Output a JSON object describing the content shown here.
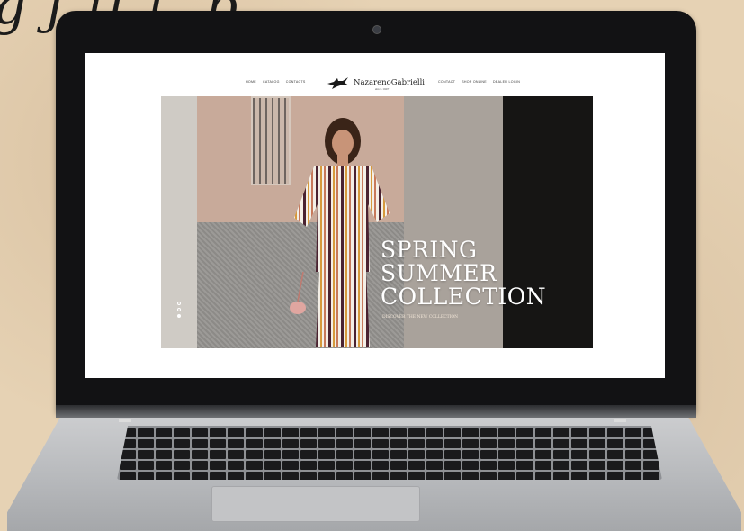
{
  "background_script_text": "g  ƒ   ff  ƒ, p",
  "website": {
    "nav_left": [
      "Home",
      "Catalog",
      "Contacts"
    ],
    "nav_right": [
      "Contact",
      "Shop Online",
      "Dealer Login"
    ],
    "brand": "NazarenoGabrielli",
    "brand_since": "since 1907",
    "hero": {
      "title_lines": [
        "SPRING",
        "SUMMER",
        "COLLECTION"
      ],
      "subtitle": "DISCOVER THE NEW COLLECTION",
      "slides": 3,
      "active_slide": 3
    }
  },
  "colors": {
    "screen_bg": "#ffffff",
    "bezel": "#121214",
    "aluminum": "#b6b8bb",
    "hero_text": "#ffffff"
  }
}
